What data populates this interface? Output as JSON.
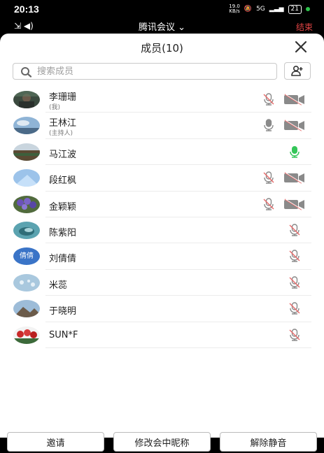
{
  "status_bar": {
    "time": "20:13",
    "net_speed": "19.0\nKB/s",
    "signal": "5G",
    "battery": "21"
  },
  "meeting": {
    "title": "腾讯会议",
    "end_label": "结束"
  },
  "panel": {
    "title": "成员(10)",
    "search_placeholder": "搜索成员",
    "members": [
      {
        "name": "李珊珊",
        "sub": "(我)",
        "avatar": "photo-dark-person",
        "mic": "muted",
        "cam": "off",
        "mic_pos": "near"
      },
      {
        "name": "王林江",
        "sub": "(主持人)",
        "avatar": "photo-sky",
        "mic": "on-gray",
        "cam": "off",
        "mic_pos": "near"
      },
      {
        "name": "马江波",
        "sub": "",
        "avatar": "photo-landscape",
        "mic": "speaking",
        "cam": "none",
        "mic_pos": "far"
      },
      {
        "name": "段红枫",
        "sub": "",
        "avatar": "photo-blue-sky",
        "mic": "muted",
        "cam": "off",
        "mic_pos": "near"
      },
      {
        "name": "金颖颖",
        "sub": "",
        "avatar": "photo-purple-flowers",
        "mic": "muted",
        "cam": "off",
        "mic_pos": "near"
      },
      {
        "name": "陈紫阳",
        "sub": "",
        "avatar": "photo-teal",
        "mic": "muted",
        "cam": "none",
        "mic_pos": "far"
      },
      {
        "name": "刘倩倩",
        "sub": "",
        "avatar": "text",
        "avatar_text": "倩倩",
        "mic": "muted",
        "cam": "none",
        "mic_pos": "far"
      },
      {
        "name": "米蕊",
        "sub": "",
        "avatar": "photo-light-blue",
        "mic": "muted",
        "cam": "none",
        "mic_pos": "far"
      },
      {
        "name": "于晓明",
        "sub": "",
        "avatar": "photo-mountain",
        "mic": "muted",
        "cam": "none",
        "mic_pos": "far"
      },
      {
        "name": "SUN*F",
        "sub": "",
        "avatar": "photo-red-flowers",
        "mic": "muted",
        "cam": "none",
        "mic_pos": "far"
      }
    ]
  },
  "footer": {
    "invite": "邀请",
    "rename": "修改会中昵称",
    "unmute_all": "解除静音"
  },
  "colors": {
    "speaking": "#34c659",
    "muted_red": "#e86a6a",
    "icon_gray": "#8a8a8a",
    "avatar_text_bg": "#3a74c7"
  }
}
